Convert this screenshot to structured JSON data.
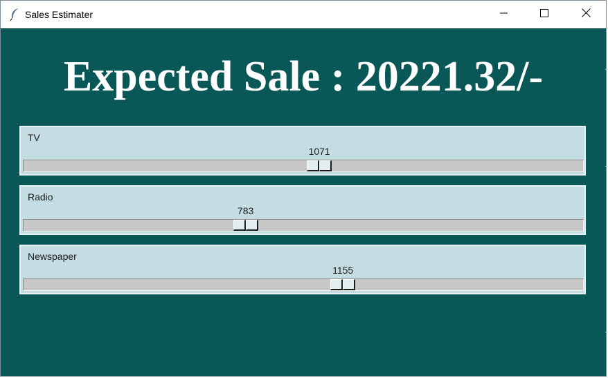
{
  "window": {
    "title": "Sales Estimater",
    "app_icon": "feather-icon",
    "controls": [
      "minimize-icon",
      "maximize-icon",
      "close-icon"
    ]
  },
  "main": {
    "headline": "Expected Sale : 20221.32/-",
    "background_color": "#0a5758",
    "panel_color": "#c4dde3"
  },
  "scales": [
    {
      "label": "TV",
      "value": "1071",
      "fraction": 0.53
    },
    {
      "label": "Radio",
      "value": "783",
      "fraction": 0.392
    },
    {
      "label": "Newspaper",
      "value": "1155",
      "fraction": 0.574
    }
  ]
}
